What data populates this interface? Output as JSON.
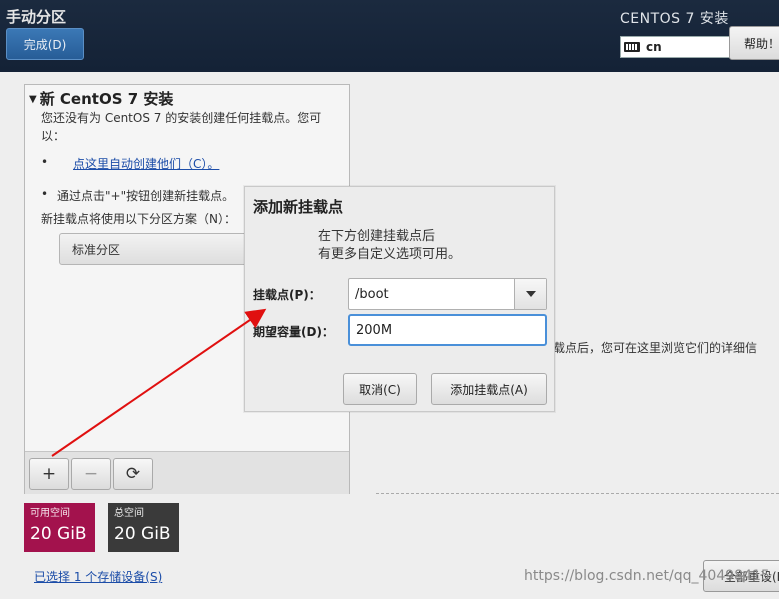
{
  "header": {
    "page_title": "手动分区",
    "done_label": "完成(D)",
    "product_title": "CENTOS 7 安装",
    "keyboard_layout": "cn",
    "help_label": "帮助！"
  },
  "left_panel": {
    "install_title": "新 CentOS 7 安装",
    "description": "您还没有为 CentOS 7 的安装创建任何挂载点。您可以：",
    "bullet": "•",
    "auto_create_link": "点这里自动创建他们（C）。",
    "manual_hint": "通过点击\"+\"按钮创建新挂载点。",
    "scheme_hint": "新挂载点将使用以下分区方案（N）：",
    "scheme_value": "标准分区",
    "toolbar": {
      "add": "+",
      "remove": "−",
      "refresh": "⟳"
    }
  },
  "space": {
    "available_label": "可用空间",
    "available_value": "20 GiB",
    "total_label": "总空间",
    "total_value": "20 GiB"
  },
  "storage_link": "已选择 1 个存储设备(S)",
  "right_hint": "载点后，您可在这里浏览它们的详细信",
  "reset_label": "全部重设(R)",
  "watermark": "https://blog.csdn.net/qq_40498415",
  "dialog": {
    "title": "添加新挂载点",
    "desc_line1": "在下方创建挂载点后",
    "desc_line2": "有更多自定义选项可用。",
    "mount_label": "挂载点(P)：",
    "mount_value": "/boot",
    "capacity_label": "期望容量(D)：",
    "capacity_value": "200M",
    "cancel_label": "取消(C)",
    "add_label": "添加挂载点(A)"
  },
  "colors": {
    "header_bg": "#1b2a3f",
    "available_bg": "#a3124d",
    "total_bg": "#3a3a3a",
    "link": "#1c4da8",
    "focus": "#4a90d9",
    "annotation_arrow": "#e01010"
  }
}
